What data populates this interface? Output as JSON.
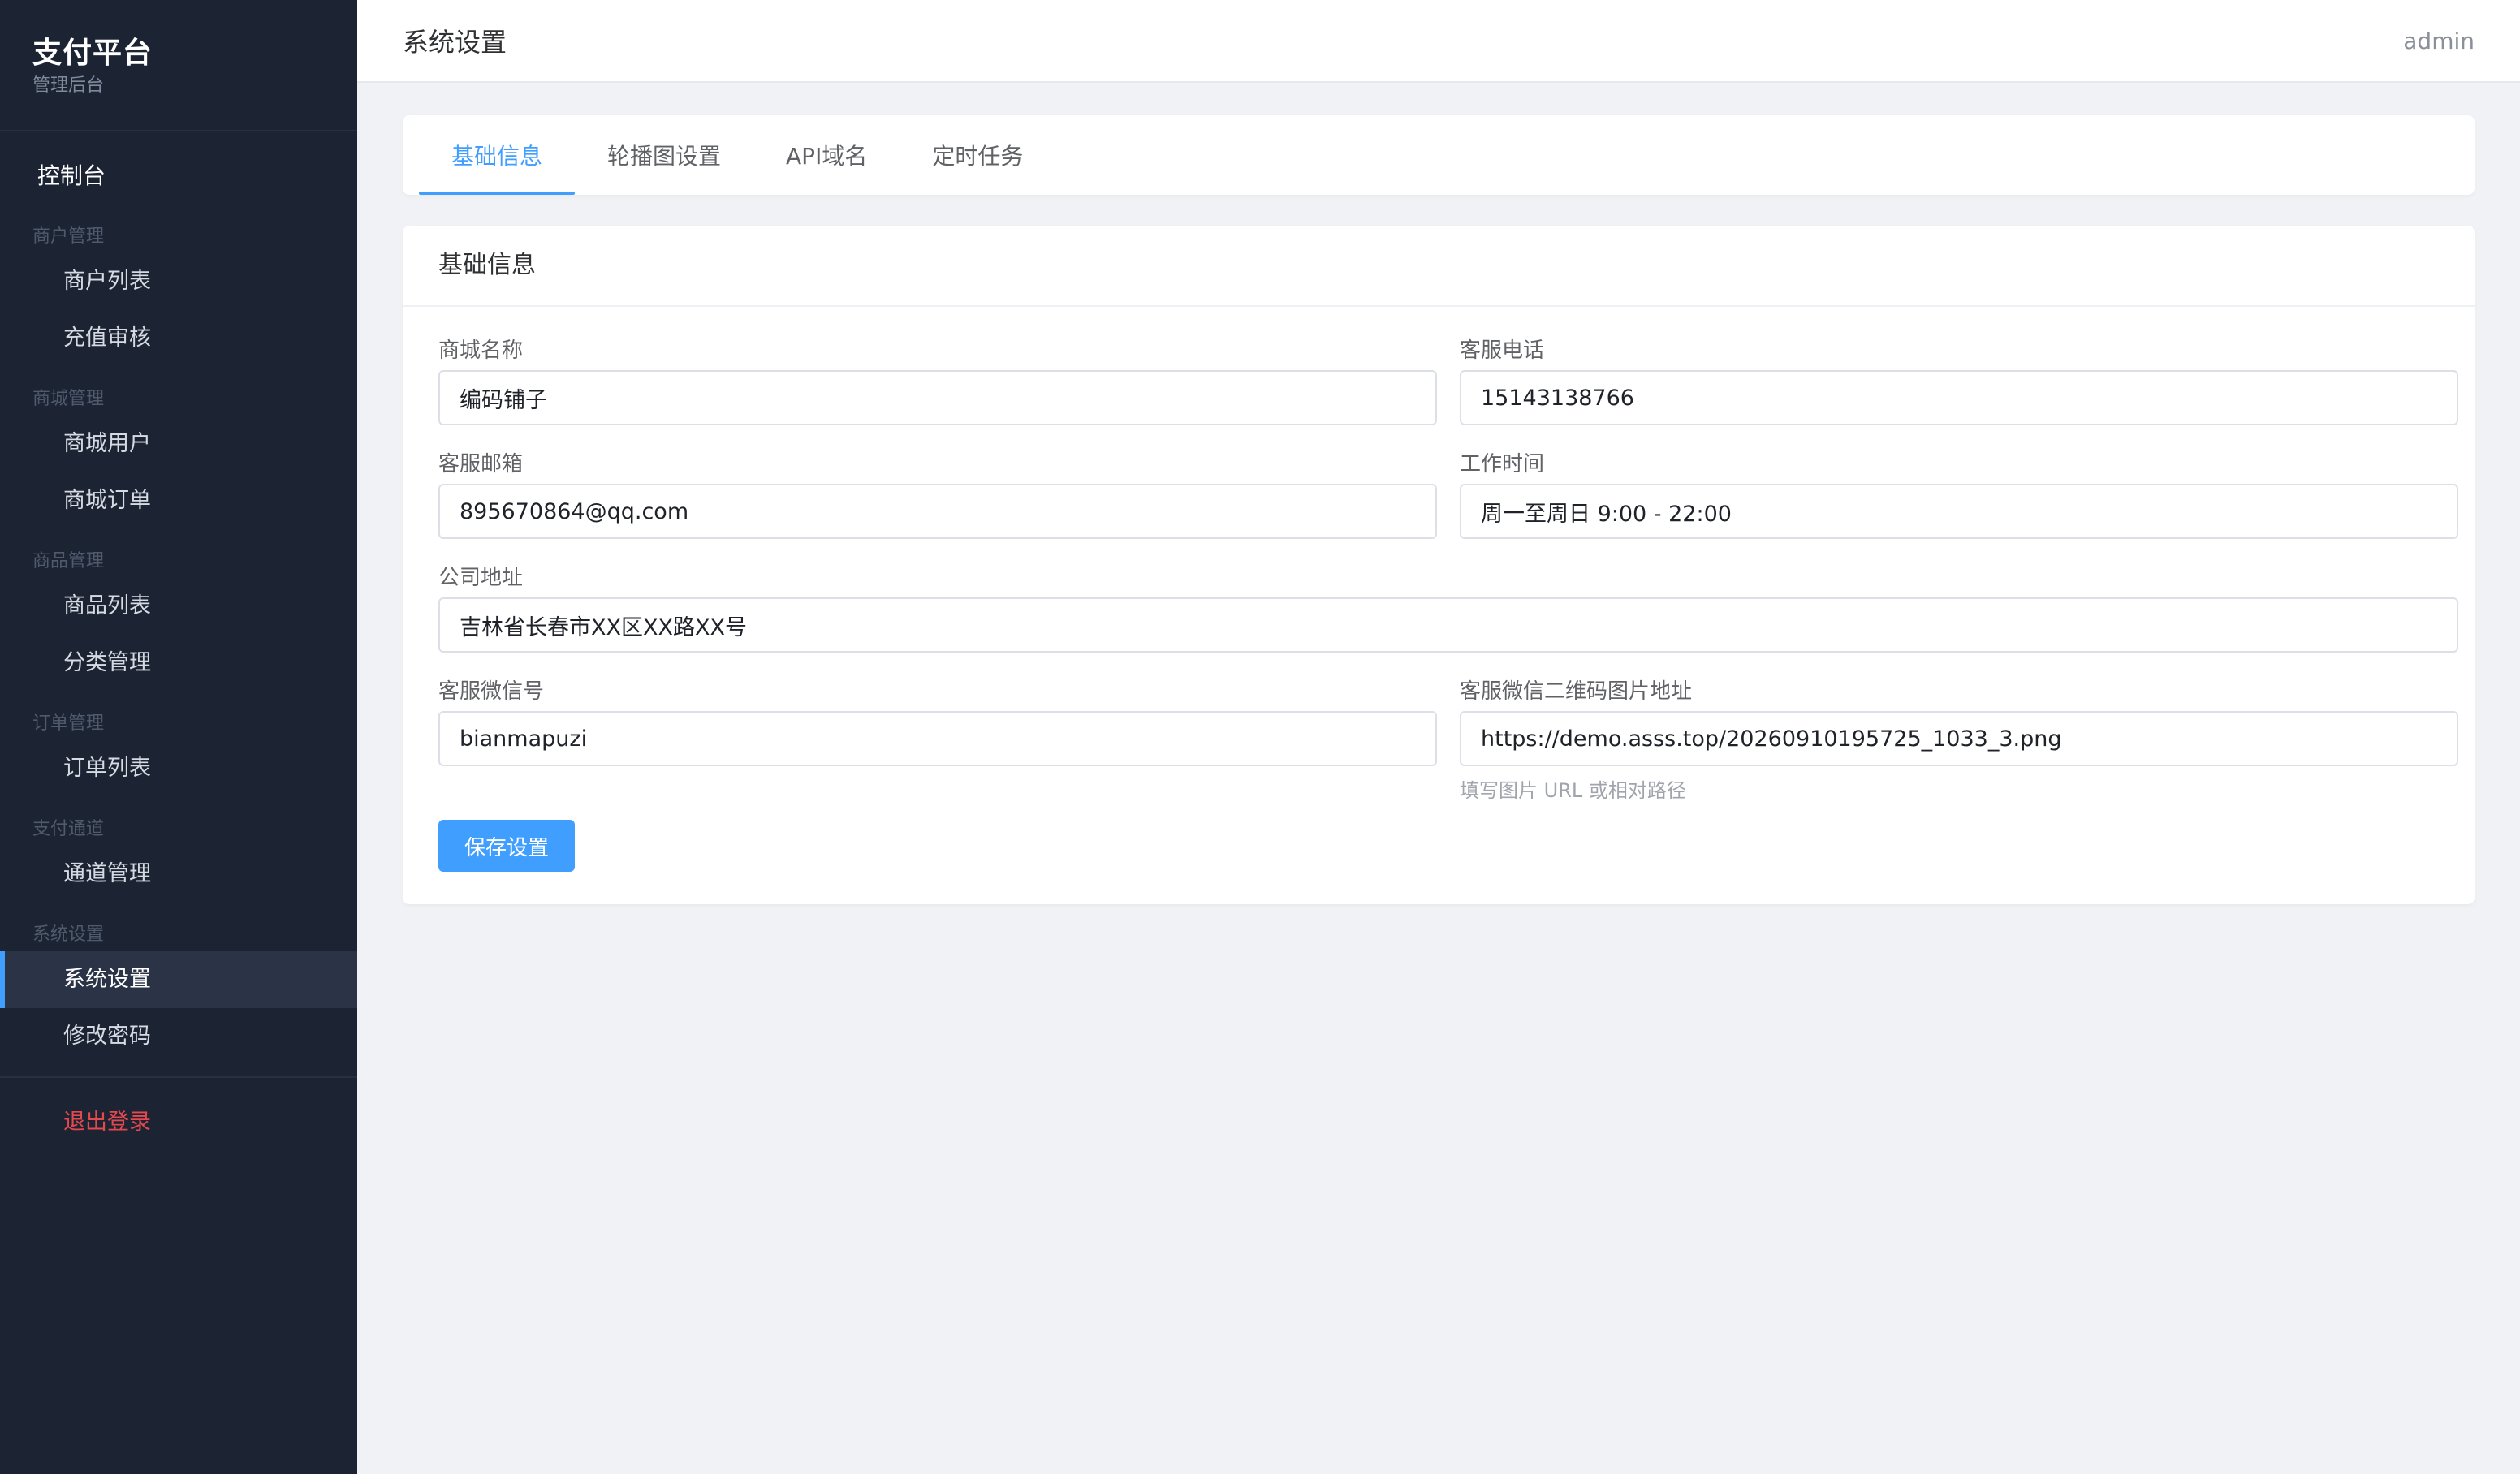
{
  "brand": {
    "title": "支付平台",
    "subtitle": "管理后台"
  },
  "sidebar": {
    "dashboard": "控制台",
    "groups": [
      {
        "label": "商户管理",
        "items": [
          {
            "label": "商户列表"
          },
          {
            "label": "充值审核"
          }
        ]
      },
      {
        "label": "商城管理",
        "items": [
          {
            "label": "商城用户"
          },
          {
            "label": "商城订单"
          }
        ]
      },
      {
        "label": "商品管理",
        "items": [
          {
            "label": "商品列表"
          },
          {
            "label": "分类管理"
          }
        ]
      },
      {
        "label": "订单管理",
        "items": [
          {
            "label": "订单列表"
          }
        ]
      },
      {
        "label": "支付通道",
        "items": [
          {
            "label": "通道管理"
          }
        ]
      },
      {
        "label": "系统设置",
        "items": [
          {
            "label": "系统设置",
            "active": true
          },
          {
            "label": "修改密码"
          }
        ]
      }
    ],
    "logout": "退出登录"
  },
  "header": {
    "title": "系统设置",
    "user": "admin"
  },
  "tabs": [
    {
      "label": "基础信息",
      "active": true
    },
    {
      "label": "轮播图设置"
    },
    {
      "label": "API域名"
    },
    {
      "label": "定时任务"
    }
  ],
  "form": {
    "section_title": "基础信息",
    "fields": {
      "shop_name": {
        "label": "商城名称",
        "value": "编码铺子"
      },
      "service_phone": {
        "label": "客服电话",
        "value": "15143138766"
      },
      "service_email": {
        "label": "客服邮箱",
        "value": "895670864@qq.com"
      },
      "work_time": {
        "label": "工作时间",
        "value": "周一至周日 9:00 - 22:00"
      },
      "company_address": {
        "label": "公司地址",
        "value": "吉林省长春市XX区XX路XX号"
      },
      "service_wechat": {
        "label": "客服微信号",
        "value": "bianmapuzi"
      },
      "wechat_qr_url": {
        "label": "客服微信二维码图片地址",
        "value": "https://demo.asss.top/20260910195725_1033_3.png",
        "hint": "填写图片 URL 或相对路径"
      }
    },
    "save_label": "保存设置"
  },
  "colors": {
    "sidebar_bg": "#1c2433",
    "accent": "#409eff",
    "danger": "#e5484d",
    "page_bg": "#f0f2f5"
  }
}
